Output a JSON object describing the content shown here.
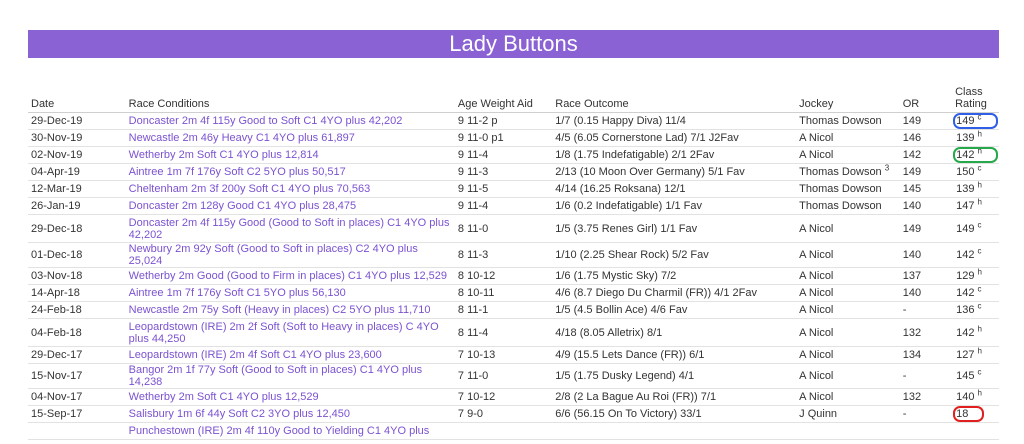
{
  "page": {
    "title": "Lady Buttons"
  },
  "columns": [
    "Date",
    "Race Conditions",
    "Age Weight Aid",
    "Race Outcome",
    "Jockey",
    "OR",
    "Class Rating"
  ],
  "rows": [
    {
      "date": "29-Dec-19",
      "race": "Doncaster 2m 4f 115y Good to Soft C1 4YO plus 42,202",
      "awa": "9 11-2 p",
      "outcome": "1/7 (0.15 Happy Diva) 11/4",
      "jockey": "Thomas Dowson",
      "jockey_sup": "",
      "or": "149",
      "rating": "149",
      "rating_sup": "c",
      "highlight": "blue",
      "tall": false
    },
    {
      "date": "30-Nov-19",
      "race": "Newcastle 2m 46y Heavy C1 4YO plus 61,897",
      "awa": "9 11-0 p1",
      "outcome": "4/5 (6.05 Cornerstone Lad) 7/1 J2Fav",
      "jockey": "A Nicol",
      "jockey_sup": "",
      "or": "146",
      "rating": "139",
      "rating_sup": "h",
      "highlight": "",
      "tall": false
    },
    {
      "date": "02-Nov-19",
      "race": "Wetherby 2m Soft C1 4YO plus 12,814",
      "awa": "9 11-4",
      "outcome": "1/8 (1.75 Indefatigable) 2/1 2Fav",
      "jockey": "A Nicol",
      "jockey_sup": "",
      "or": "142",
      "rating": "142",
      "rating_sup": "h",
      "highlight": "green",
      "tall": false
    },
    {
      "date": "04-Apr-19",
      "race": "Aintree 1m 7f 176y Soft C2 5YO plus 50,517",
      "awa": "9 11-3",
      "outcome": "2/13 (10 Moon Over Germany) 5/1 Fav",
      "jockey": "Thomas Dowson",
      "jockey_sup": "3",
      "or": "149",
      "rating": "150",
      "rating_sup": "c",
      "highlight": "",
      "tall": false
    },
    {
      "date": "12-Mar-19",
      "race": "Cheltenham 2m 3f 200y Soft C1 4YO plus 70,563",
      "awa": "9 11-5",
      "outcome": "4/14 (16.25 Roksana) 12/1",
      "jockey": "Thomas Dowson",
      "jockey_sup": "",
      "or": "145",
      "rating": "139",
      "rating_sup": "h",
      "highlight": "",
      "tall": false
    },
    {
      "date": "26-Jan-19",
      "race": "Doncaster 2m 128y Good C1 4YO plus 28,475",
      "awa": "9 11-4",
      "outcome": "1/6 (0.2 Indefatigable) 1/1 Fav",
      "jockey": "Thomas Dowson",
      "jockey_sup": "",
      "or": "140",
      "rating": "147",
      "rating_sup": "h",
      "highlight": "",
      "tall": false
    },
    {
      "date": "29-Dec-18",
      "race": "Doncaster 2m 4f 115y Good (Good to Soft in places) C1 4YO plus 42,202",
      "awa": "8 11-0",
      "outcome": "1/5 (3.75 Renes Girl) 1/1 Fav",
      "jockey": "A Nicol",
      "jockey_sup": "",
      "or": "149",
      "rating": "149",
      "rating_sup": "c",
      "highlight": "",
      "tall": true
    },
    {
      "date": "01-Dec-18",
      "race": "Newbury 2m 92y Soft (Good to Soft in places) C2 4YO plus 25,024",
      "awa": "8 11-3",
      "outcome": "1/10 (2.25 Shear Rock) 5/2 Fav",
      "jockey": "A Nicol",
      "jockey_sup": "",
      "or": "140",
      "rating": "142",
      "rating_sup": "c",
      "highlight": "",
      "tall": false
    },
    {
      "date": "03-Nov-18",
      "race": "Wetherby 2m Good (Good to Firm in places) C1 4YO plus 12,529",
      "awa": "8 10-12",
      "outcome": "1/6 (1.75 Mystic Sky) 7/2",
      "jockey": "A Nicol",
      "jockey_sup": "",
      "or": "137",
      "rating": "129",
      "rating_sup": "h",
      "highlight": "",
      "tall": false
    },
    {
      "date": "14-Apr-18",
      "race": "Aintree 1m 7f 176y Soft C1 5YO plus 56,130",
      "awa": "8 10-11",
      "outcome": "4/6 (8.7 Diego Du Charmil (FR)) 4/1 2Fav",
      "jockey": "A Nicol",
      "jockey_sup": "",
      "or": "140",
      "rating": "142",
      "rating_sup": "c",
      "highlight": "",
      "tall": false
    },
    {
      "date": "24-Feb-18",
      "race": "Newcastle 2m 75y Soft (Heavy in places) C2 5YO plus 11,710",
      "awa": "8 11-1",
      "outcome": "1/5 (4.5 Bollin Ace) 4/6 Fav",
      "jockey": "A Nicol",
      "jockey_sup": "",
      "or": "-",
      "rating": "136",
      "rating_sup": "c",
      "highlight": "",
      "tall": false
    },
    {
      "date": "04-Feb-18",
      "race": "Leopardstown (IRE) 2m 2f Soft (Soft to Heavy in places) C 4YO plus 44,250",
      "awa": "8 11-4",
      "outcome": "4/18 (8.05 Alletrix) 8/1",
      "jockey": "A Nicol",
      "jockey_sup": "",
      "or": "132",
      "rating": "142",
      "rating_sup": "h",
      "highlight": "",
      "tall": true
    },
    {
      "date": "29-Dec-17",
      "race": "Leopardstown (IRE) 2m 4f Soft C1 4YO plus 23,600",
      "awa": "7 10-13",
      "outcome": "4/9 (15.5 Lets Dance (FR)) 6/1",
      "jockey": "A Nicol",
      "jockey_sup": "",
      "or": "134",
      "rating": "127",
      "rating_sup": "h",
      "highlight": "",
      "tall": false
    },
    {
      "date": "15-Nov-17",
      "race": "Bangor 2m 1f 77y Soft (Good to Soft in places) C1 4YO plus 14,238",
      "awa": "7 11-0",
      "outcome": "1/5 (1.75 Dusky Legend) 4/1",
      "jockey": "A Nicol",
      "jockey_sup": "",
      "or": "-",
      "rating": "145",
      "rating_sup": "c",
      "highlight": "",
      "tall": false
    },
    {
      "date": "04-Nov-17",
      "race": "Wetherby 2m Soft C1 4YO plus 12,529",
      "awa": "7 10-12",
      "outcome": "2/8 (2 La Bague Au Roi (FR)) 7/1",
      "jockey": "A Nicol",
      "jockey_sup": "",
      "or": "132",
      "rating": "140",
      "rating_sup": "h",
      "highlight": "",
      "tall": false
    },
    {
      "date": "15-Sep-17",
      "race": "Salisbury 1m 6f 44y Soft C2 3YO plus 12,450",
      "awa": "7 9-0",
      "outcome": "6/6 (56.15 On To Victory) 33/1",
      "jockey": "J Quinn",
      "jockey_sup": "",
      "or": "-",
      "rating": "18",
      "rating_sup": "",
      "highlight": "red",
      "tall": false
    },
    {
      "date": "",
      "race": "Punchestown (IRE) 2m 4f 110y Good to Yielding C1 4YO plus",
      "awa": "",
      "outcome": "",
      "jockey": "",
      "jockey_sup": "",
      "or": "",
      "rating": "",
      "rating_sup": "",
      "highlight": "",
      "tall": false
    }
  ],
  "colors": {
    "header_bar": "#8a62d4",
    "link": "#7b52d1"
  }
}
